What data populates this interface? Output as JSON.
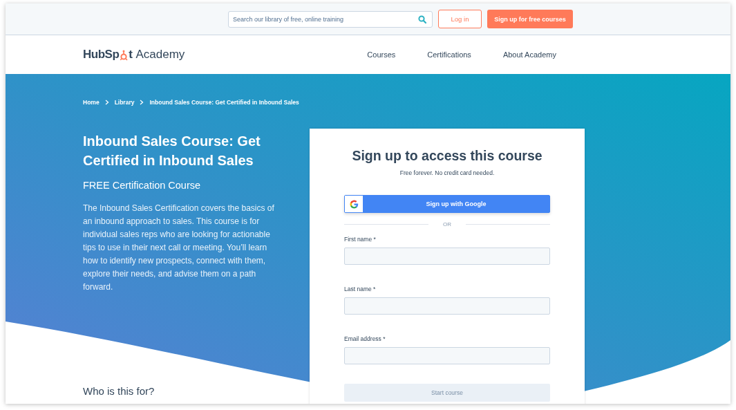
{
  "top_bar": {
    "search": {
      "placeholder": "Search our library of free, online training"
    },
    "login_button": "Log in",
    "signup_button": "Sign up for free courses"
  },
  "nav": {
    "logo": {
      "brand_start": "HubSp",
      "brand_end": "t",
      "product": "Academy"
    },
    "links": [
      "Courses",
      "Certifications",
      "About Academy"
    ]
  },
  "breadcrumb": [
    "Home",
    "Library",
    "Inbound Sales Course: Get Certified in Inbound Sales"
  ],
  "course": {
    "title": "Inbound Sales Course: Get Certified in Inbound Sales",
    "subtitle": "FREE Certification Course",
    "description": "The Inbound Sales Certification covers the basics of an inbound approach to sales. This course is for individual sales reps who are looking for actionable tips to use in their next call or meeting. You’ll learn how to identify new prospects, connect with them, explore their needs, and advise them on a path forward.",
    "section_heading": "Who is this for?"
  },
  "signup_card": {
    "title": "Sign up to access this course",
    "subtitle": "Free forever. No credit card needed.",
    "google_button": "Sign up with Google",
    "divider": "OR",
    "fields": [
      {
        "label": "First name *"
      },
      {
        "label": "Last name *"
      },
      {
        "label": "Email address *"
      }
    ],
    "submit": {
      "label": "Start course",
      "disabled": true
    }
  }
}
